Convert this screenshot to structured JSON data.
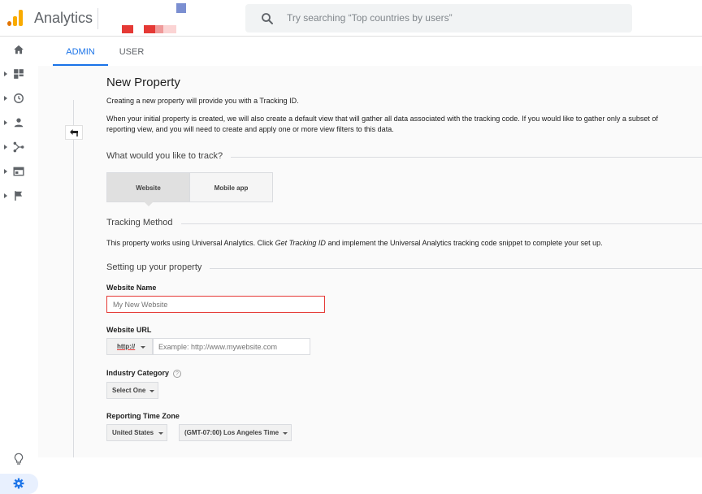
{
  "app": {
    "name": "Analytics"
  },
  "colors": {
    "accent": "#1a73e8",
    "logo_orange": "#f9ab00",
    "logo_dark": "#e37400",
    "error_red": "#e53935"
  },
  "search": {
    "placeholder": "Try searching “Top countries by users”"
  },
  "nav": {
    "items": [
      "home-icon",
      "dashboard-icon",
      "clock-icon",
      "person-icon",
      "acquisition-icon",
      "behavior-icon",
      "flag-icon"
    ],
    "bottom": [
      "lightbulb-icon",
      "gear-icon"
    ]
  },
  "tabs": [
    {
      "label": "ADMIN",
      "active": true
    },
    {
      "label": "USER",
      "active": false
    }
  ],
  "page": {
    "title": "New Property",
    "intro": "Creating a new property will provide you with a Tracking ID.",
    "desc_line1": "When your initial property is created, we will also create a default view that will gather all data associated with the tracking code. If you would like to gather only a subset of",
    "desc_line2": "reporting view, and you will need to create and apply one or more view filters to this data."
  },
  "track": {
    "heading": "What would you like to track?",
    "options": [
      {
        "label": "Website",
        "selected": true
      },
      {
        "label": "Mobile app",
        "selected": false
      }
    ]
  },
  "method": {
    "heading": "Tracking Method",
    "text_before": "This property works using Universal Analytics. Click ",
    "text_emph": "Get Tracking ID",
    "text_after": " and implement the Universal Analytics tracking code snippet to complete your set up."
  },
  "setup": {
    "heading": "Setting up your property",
    "website_name_label": "Website Name",
    "website_name_placeholder": "My New Website",
    "website_url_label": "Website URL",
    "protocol": "http://",
    "url_placeholder": "Example: http://www.mywebsite.com",
    "industry_label": "Industry Category",
    "industry_value": "Select One",
    "timezone_label": "Reporting Time Zone",
    "country_value": "United States",
    "timezone_value": "(GMT-07:00) Los Angeles Time"
  }
}
